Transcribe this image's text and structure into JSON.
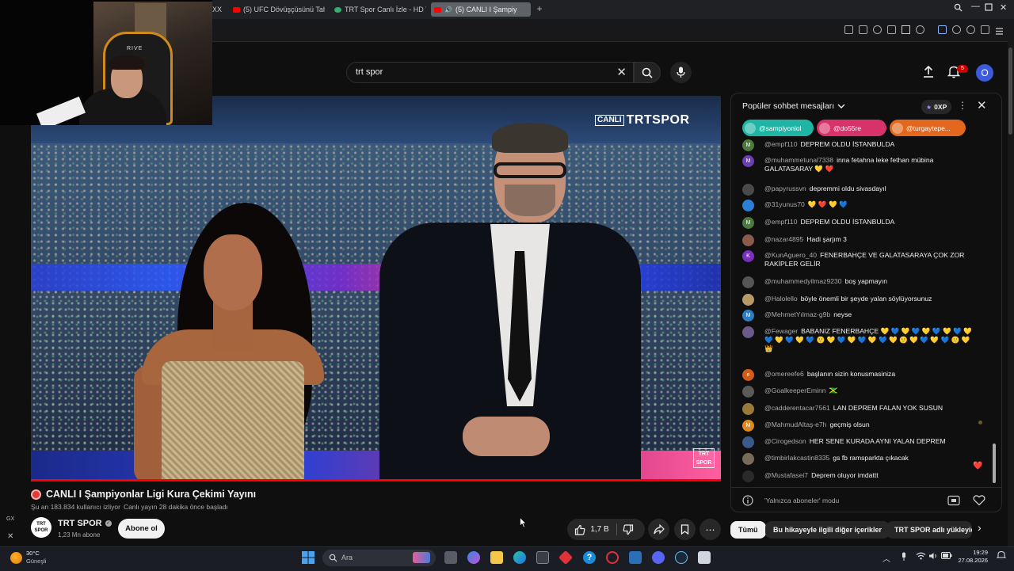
{
  "browser": {
    "tabs": [
      {
        "label": "(5) UFC Dövüşçüsünü Tah",
        "icon": "youtube-favicon"
      },
      {
        "label": "TRT Spor Canlı İzle - HD Y",
        "icon": "trt-favicon"
      },
      {
        "label": "(5) CANLI I Şampiy",
        "icon": "youtube-favicon",
        "active": true
      }
    ],
    "partial_tab": "XX",
    "new_tab": "+"
  },
  "header": {
    "search_value": "trt spor",
    "notification_count": "5",
    "avatar_letter": "O"
  },
  "video": {
    "overlay_logo_canli": "CANLI",
    "overlay_logo_main": "TRTSPOR",
    "bug_line1": "TRT",
    "bug_line2": "SPOR",
    "progress": 1.0
  },
  "webcam": {
    "chair_brand": "RIVE"
  },
  "sidebar": {
    "gx_label": "GX",
    "close_label": "✕"
  },
  "details": {
    "title": "CANLI I Şampiyonlar Ligi Kura Çekimi Yayını",
    "viewers": "Şu an 183.834 kullanıcı izliyor",
    "started": "Canlı yayın 28 dakika önce başladı",
    "channel_name": "TRT SPOR",
    "channel_logo_top": "TRT",
    "channel_logo_bottom": "SPOR",
    "subscribers": "1,23 Mn abone",
    "subscribe_label": "Abone ol",
    "likes": "1,7 B"
  },
  "chat": {
    "header": "Popüler sohbet mesajları",
    "xp": "0XP",
    "pinned": [
      {
        "name": "@sampiyoniol",
        "color": "#1fb5a5"
      },
      {
        "name": "@do55re",
        "color": "#d8326a"
      },
      {
        "name": "@turgaytepe...",
        "color": "#e3681e"
      }
    ],
    "messages": [
      {
        "author": "@empf110",
        "text": "DEPREM OLDU İSTANBULDA",
        "avatar": "M",
        "color": "#4c7a3a"
      },
      {
        "author": "@muhammetunal7338",
        "text": "inna fetahna leke fethan mübina GALATASARAY 💛 ❤️",
        "avatar": "M",
        "color": "#6a3fb5"
      },
      {
        "author": "@papyrussvn",
        "text": "depremmi oldu sivasdayıl",
        "avatar": "",
        "color": "#4a4a4a"
      },
      {
        "author": "@31yunus70",
        "text": "💛 ❤️ 💛 💙",
        "avatar": "",
        "color": "#2c7fd6"
      },
      {
        "author": "@empf110",
        "text": "DEPREM OLDU İSTANBULDA",
        "avatar": "M",
        "color": "#4c7a3a"
      },
      {
        "author": "@nazar4895",
        "text": "Hadi şarjım 3",
        "avatar": "",
        "color": "#8a5a4a"
      },
      {
        "author": "@KunAguero_40",
        "text": "FENERBAHÇE VE GALATASARAYA ÇOK ZOR RAKİPLER GELİR",
        "avatar": "K",
        "color": "#7b2fbe"
      },
      {
        "author": "@muhammedyilmaz9230",
        "text": "boş yapmayın",
        "avatar": "",
        "color": "#555555"
      },
      {
        "author": "@Halolello",
        "text": "böyle önemli bir şeyde yalan söylüyorsunuz",
        "avatar": "",
        "color": "#b89a6a"
      },
      {
        "author": "@MehmetYılmaz-g9b",
        "text": "neyse",
        "avatar": "M",
        "color": "#2a7fc4"
      },
      {
        "author": "@Fewager",
        "text": "BABANIZ FENERBAHÇE 💛 💙 💛 💙 💛 💙 💛 💙 💛 💙 💛 💙 💛 💙 🙂 💛 💙 💛 💙 💛 💙 💛 🙂 💛 💙 💛 💙 🙂 💛 👑",
        "avatar": "",
        "color": "#6a5a8a"
      },
      {
        "author": "@omereefe6",
        "text": "başlanın sizin konusmasiniza",
        "avatar": "e",
        "color": "#d45a16"
      },
      {
        "author": "@GoalkeeperEminn",
        "text": "🇯🇲",
        "avatar": "",
        "color": "#5a5a5a"
      },
      {
        "author": "@cadderentacar7561",
        "text": "LAN DEPREM FALAN YOK SUSUN",
        "avatar": "",
        "color": "#9a7a3a"
      },
      {
        "author": "@MahmudAltaş-e7h",
        "text": "geçmiş olsun",
        "avatar": "M",
        "color": "#e08a1a"
      },
      {
        "author": "@Cirogedson",
        "text": "HER SENE KURADA AYNI YALAN DEPREM",
        "avatar": "",
        "color": "#3a5a8a"
      },
      {
        "author": "@timbirlakcastin8335",
        "text": "gs fb ramsparkta çıkacak",
        "avatar": "",
        "color": "#7a6a5a"
      },
      {
        "author": "@Mustafasei7",
        "text": "Deprem oluyor imdattt",
        "avatar": "",
        "color": "#2a2a2a"
      }
    ],
    "footer_text": "'Yalnızca aboneler' modu"
  },
  "chips": [
    "Tümü",
    "Bu hikayeyle ilgili diğer içerikler",
    "TRT SPOR adlı yükleyic"
  ],
  "taskbar": {
    "temp": "30°C",
    "weather": "Güneşli",
    "search_placeholder": "Ara",
    "time": "19:29",
    "date": "27.08.2026"
  }
}
